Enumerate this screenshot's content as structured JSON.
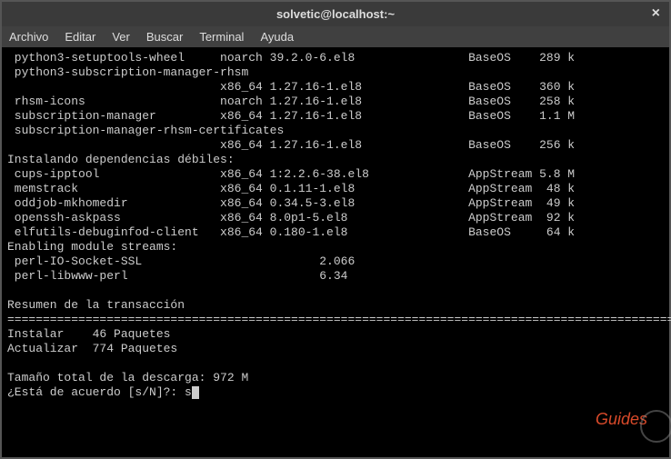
{
  "window": {
    "title": "solvetic@localhost:~",
    "close": "×"
  },
  "menubar": [
    "Archivo",
    "Editar",
    "Ver",
    "Buscar",
    "Terminal",
    "Ayuda"
  ],
  "packages": [
    {
      "name": " python3-setuptools-wheel",
      "arch": "noarch",
      "ver": "39.2.0-6.el8",
      "repo": "BaseOS",
      "size": "289 k"
    },
    {
      "name": " python3-subscription-manager-rhsm",
      "arch": "",
      "ver": "",
      "repo": "",
      "size": ""
    },
    {
      "name": "",
      "arch": "x86_64",
      "ver": "1.27.16-1.el8",
      "repo": "BaseOS",
      "size": "360 k"
    },
    {
      "name": " rhsm-icons",
      "arch": "noarch",
      "ver": "1.27.16-1.el8",
      "repo": "BaseOS",
      "size": "258 k"
    },
    {
      "name": " subscription-manager",
      "arch": "x86_64",
      "ver": "1.27.16-1.el8",
      "repo": "BaseOS",
      "size": "1.1 M"
    },
    {
      "name": " subscription-manager-rhsm-certificates",
      "arch": "",
      "ver": "",
      "repo": "",
      "size": ""
    },
    {
      "name": "",
      "arch": "x86_64",
      "ver": "1.27.16-1.el8",
      "repo": "BaseOS",
      "size": "256 k"
    }
  ],
  "weak_deps_header": "Instalando dependencias débiles:",
  "weak_deps": [
    {
      "name": " cups-ipptool",
      "arch": "x86_64",
      "ver": "1:2.2.6-38.el8",
      "repo": "AppStream",
      "size": "5.8 M"
    },
    {
      "name": " memstrack",
      "arch": "x86_64",
      "ver": "0.1.11-1.el8",
      "repo": "AppStream",
      "size": " 48 k"
    },
    {
      "name": " oddjob-mkhomedir",
      "arch": "x86_64",
      "ver": "0.34.5-3.el8",
      "repo": "AppStream",
      "size": " 49 k"
    },
    {
      "name": " openssh-askpass",
      "arch": "x86_64",
      "ver": "8.0p1-5.el8",
      "repo": "AppStream",
      "size": " 92 k"
    },
    {
      "name": " elfutils-debuginfod-client",
      "arch": "x86_64",
      "ver": "0.180-1.el8",
      "repo": "BaseOS",
      "size": " 64 k"
    }
  ],
  "module_header": "Enabling module streams:",
  "modules": [
    {
      "name": " perl-IO-Socket-SSL",
      "ver": "2.066"
    },
    {
      "name": " perl-libwww-perl",
      "ver": "6.34"
    }
  ],
  "summary": {
    "header": "Resumen de la transacción",
    "separator": "================================================================================================",
    "install": "Instalar    46 Paquetes",
    "update": "Actualizar  774 Paquetes",
    "total": "Tamaño total de la descarga: 972 M",
    "prompt": "¿Está de acuerdo [s/N]?: ",
    "answer": "s"
  },
  "watermark": "Guides"
}
